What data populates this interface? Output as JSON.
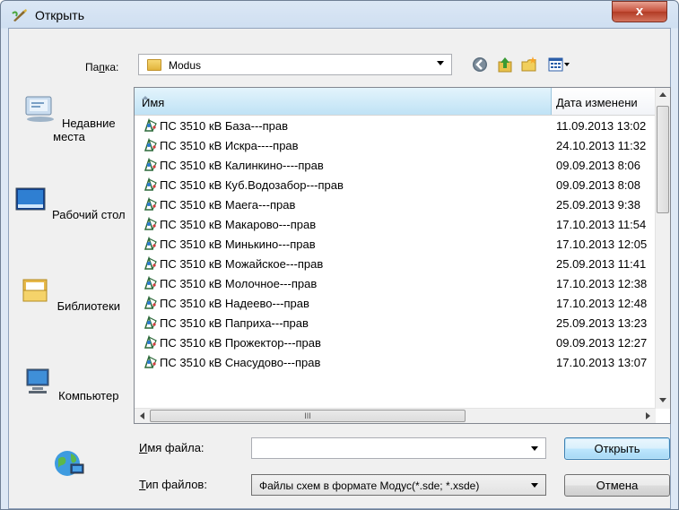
{
  "window": {
    "title": "Открыть",
    "close_label": "x"
  },
  "folder": {
    "label": "Папка:",
    "label_underline": "п",
    "current": "Modus"
  },
  "toolbar": {
    "icons": [
      "back-icon",
      "up-folder-icon",
      "new-folder-icon",
      "view-menu-icon"
    ]
  },
  "places": [
    {
      "label": "Недавние места",
      "icon": "recent-places-icon"
    },
    {
      "label": "Рабочий стол",
      "icon": "desktop-icon"
    },
    {
      "label": "Библиотеки",
      "icon": "libraries-icon"
    },
    {
      "label": "Компьютер",
      "icon": "computer-icon"
    },
    {
      "label": "",
      "icon": "network-icon"
    }
  ],
  "columns": {
    "name": "Имя",
    "date": "Дата изменени"
  },
  "files": [
    {
      "name": "ПС 3510 кВ База---прав",
      "date": "11.09.2013 13:02"
    },
    {
      "name": "ПС 3510 кВ Искра----прав",
      "date": "24.10.2013 11:32"
    },
    {
      "name": "ПС 3510 кВ Калинкино----прав",
      "date": "09.09.2013 8:06"
    },
    {
      "name": "ПС 3510 кВ Куб.Водозабор---прав",
      "date": "09.09.2013 8:08"
    },
    {
      "name": "ПС 3510 кВ Маега---прав",
      "date": "25.09.2013 9:38"
    },
    {
      "name": "ПС 3510 кВ Макарово---прав",
      "date": "17.10.2013 11:54"
    },
    {
      "name": "ПС 3510 кВ Минькино---прав",
      "date": "17.10.2013 12:05"
    },
    {
      "name": "ПС 3510 кВ Можайское---прав",
      "date": "25.09.2013 11:41"
    },
    {
      "name": "ПС 3510 кВ Молочное---прав",
      "date": "17.10.2013 12:38"
    },
    {
      "name": "ПС 3510 кВ Надеево---прав",
      "date": "17.10.2013 12:48"
    },
    {
      "name": "ПС 3510 кВ Паприха---прав",
      "date": "25.09.2013 13:23"
    },
    {
      "name": "ПС 3510 кВ Прожектор---прав",
      "date": "09.09.2013 12:27"
    },
    {
      "name": "ПС 3510 кВ Снасудово---прав",
      "date": "17.10.2013 13:07"
    }
  ],
  "hscroll_grip": "III",
  "filename": {
    "label_pre": "",
    "label_underline": "И",
    "label_post": "мя файла:",
    "value": ""
  },
  "filetype": {
    "label_underline": "Т",
    "label_post": "ип файлов:",
    "value": "Файлы схем в формате Модус(*.sde; *.xsde)"
  },
  "buttons": {
    "open": "Открыть",
    "cancel": "Отмена"
  },
  "colors": {
    "title_bar": "#cfdff1",
    "close": "#c6503b",
    "selected_header": "#bfe2f5"
  }
}
